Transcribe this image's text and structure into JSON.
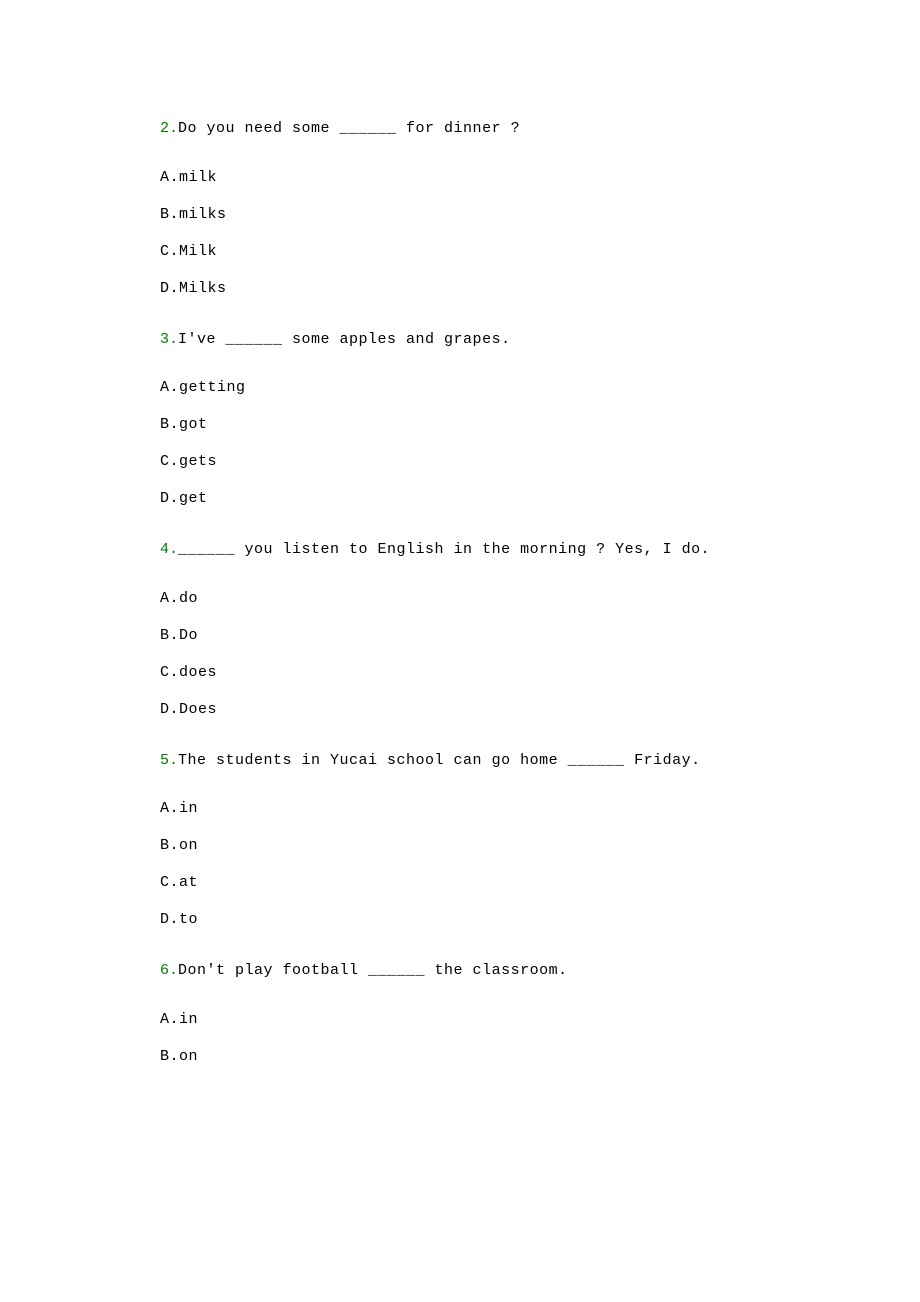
{
  "questions": [
    {
      "num": "2.",
      "text": "Do you need some ______ for dinner ?",
      "options": [
        "A.milk",
        "B.milks",
        "C.Milk",
        "D.Milks"
      ]
    },
    {
      "num": "3.",
      "text": "I've ______ some apples and grapes.",
      "options": [
        "A.getting",
        "B.got",
        "C.gets",
        "D.get"
      ]
    },
    {
      "num": "4.",
      "text": "______ you listen to English in the morning ? Yes, I do.",
      "options": [
        "A.do",
        "B.Do",
        "C.does",
        "D.Does"
      ]
    },
    {
      "num": "5.",
      "text": "The students in Yucai school can go home ______ Friday.",
      "options": [
        "A.in",
        "B.on",
        "C.at",
        "D.to"
      ]
    },
    {
      "num": "6.",
      "text": "Don't play football ______ the classroom.",
      "options": [
        "A.in",
        "B.on"
      ]
    }
  ]
}
